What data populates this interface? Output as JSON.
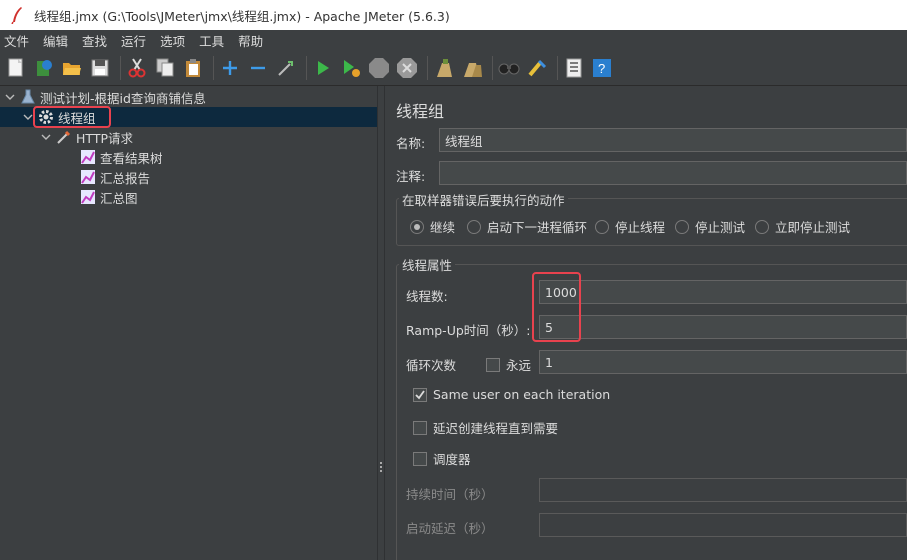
{
  "window": {
    "title": "线程组.jmx (G:\\Tools\\JMeter\\jmx\\线程组.jmx) - Apache JMeter (5.6.3)"
  },
  "menu": [
    "文件",
    "编辑",
    "查找",
    "运行",
    "选项",
    "工具",
    "帮助"
  ],
  "toolbar": {
    "icons": [
      "new-icon",
      "templates-icon",
      "open-icon",
      "save-icon",
      "cut-icon",
      "copy-icon",
      "paste-icon",
      "expand-icon",
      "collapse-icon",
      "toggle-icon",
      "start-icon",
      "start-no-pause-icon",
      "stop-icon",
      "shutdown-icon",
      "clear-icon",
      "clear-all-icon",
      "search-icon",
      "reset-search-icon",
      "function-helper-icon",
      "help-icon"
    ]
  },
  "tree": {
    "root": "测试计划-根据id查询商铺信息",
    "thread_group": "线程组",
    "http_request": "HTTP请求",
    "children": [
      "查看结果树",
      "汇总报告",
      "汇总图"
    ]
  },
  "panel": {
    "title": "线程组",
    "name_label": "名称:",
    "name_value": "线程组",
    "comment_label": "注释:",
    "comment_value": "",
    "error_group_title": "在取样器错误后要执行的动作",
    "error_actions": [
      {
        "label": "继续",
        "selected": true
      },
      {
        "label": "启动下一进程循环",
        "selected": false
      },
      {
        "label": "停止线程",
        "selected": false
      },
      {
        "label": "停止测试",
        "selected": false
      },
      {
        "label": "立即停止测试",
        "selected": false
      }
    ],
    "props_group_title": "线程属性",
    "threads_label": "线程数:",
    "threads_value": "1000",
    "rampup_label": "Ramp-Up时间（秒）:",
    "rampup_value": "5",
    "loop_label": "循环次数",
    "forever_label": "永远",
    "loop_value": "1",
    "same_user_label": "Same user on each iteration",
    "delay_label": "延迟创建线程直到需要",
    "scheduler_label": "调度器",
    "duration_label": "持续时间（秒）",
    "startup_delay_label": "启动延迟（秒）"
  },
  "colors": {
    "highlight": "#e8424e",
    "selection": "#0d293e",
    "background": "#3c3f41"
  }
}
